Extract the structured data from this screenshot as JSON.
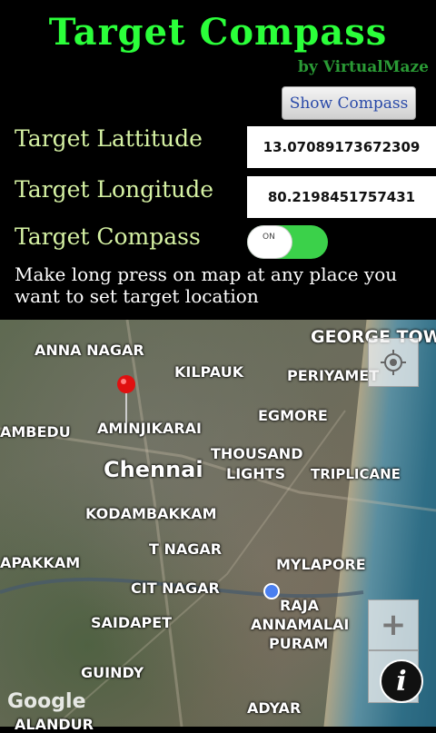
{
  "header": {
    "title": "Target Compass",
    "subtitle": "by VirtualMaze"
  },
  "toolbar": {
    "show_compass_label": "Show Compass"
  },
  "form": {
    "latitude_label": "Target Lattitude",
    "latitude_value": "13.07089173672309",
    "longitude_label": "Target Longitude",
    "longitude_value": "80.2198451757431",
    "compass_label": "Target Compass",
    "compass_toggle_text": "ON",
    "compass_enabled": true
  },
  "hint": "Make long press on map at any place you want to set target location",
  "map": {
    "places": [
      "GEORGE TOWN",
      "ANNA NAGAR",
      "KILPAUK",
      "PERIYAMET",
      "EGMORE",
      "AMBEDU",
      "AMINJIKARAI",
      "Chennai",
      "THOUSAND",
      "LIGHTS",
      "TRIPLICANE",
      "KODAMBAKKAM",
      "T NAGAR",
      "APAKKAM",
      "MYLAPORE",
      "CIT NAGAR",
      "RAJA",
      "ANNAMALAI",
      "PURAM",
      "SAIDAPET",
      "GUINDY",
      "ADYAR",
      "ALANDUR"
    ],
    "attribution": "Google",
    "zoom_in_label": "+",
    "info_label": "i"
  }
}
